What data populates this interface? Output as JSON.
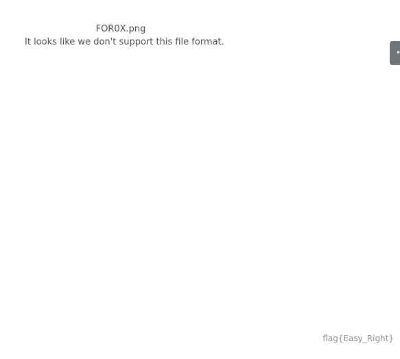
{
  "viewer": {
    "file_name": "FOR0X.png",
    "message": "It looks like we don't support this file format."
  },
  "side_panel": {
    "icon": "arrow-icon",
    "glyph": "←"
  },
  "footer": {
    "flag": "flag{Easy_Right}"
  }
}
